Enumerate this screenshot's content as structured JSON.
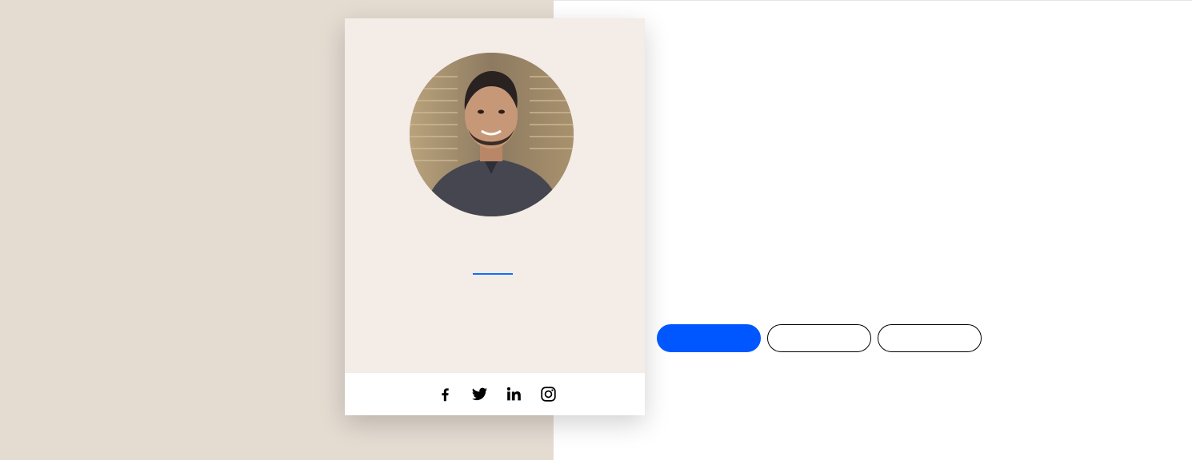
{
  "colors": {
    "left_panel_bg": "#e4dbd1",
    "card_bg": "#f3ece7",
    "accent": "#0057ff",
    "divider": "#116dff",
    "social_bar_bg": "#ffffff",
    "icon_color": "#000000"
  },
  "profile": {
    "photo_icon": "profile-photo",
    "name": "",
    "title": ""
  },
  "social": {
    "icons": [
      "facebook-icon",
      "twitter-icon",
      "linkedin-icon",
      "instagram-icon"
    ]
  },
  "actions": {
    "primary_label": "",
    "secondary_label": "",
    "tertiary_label": ""
  }
}
